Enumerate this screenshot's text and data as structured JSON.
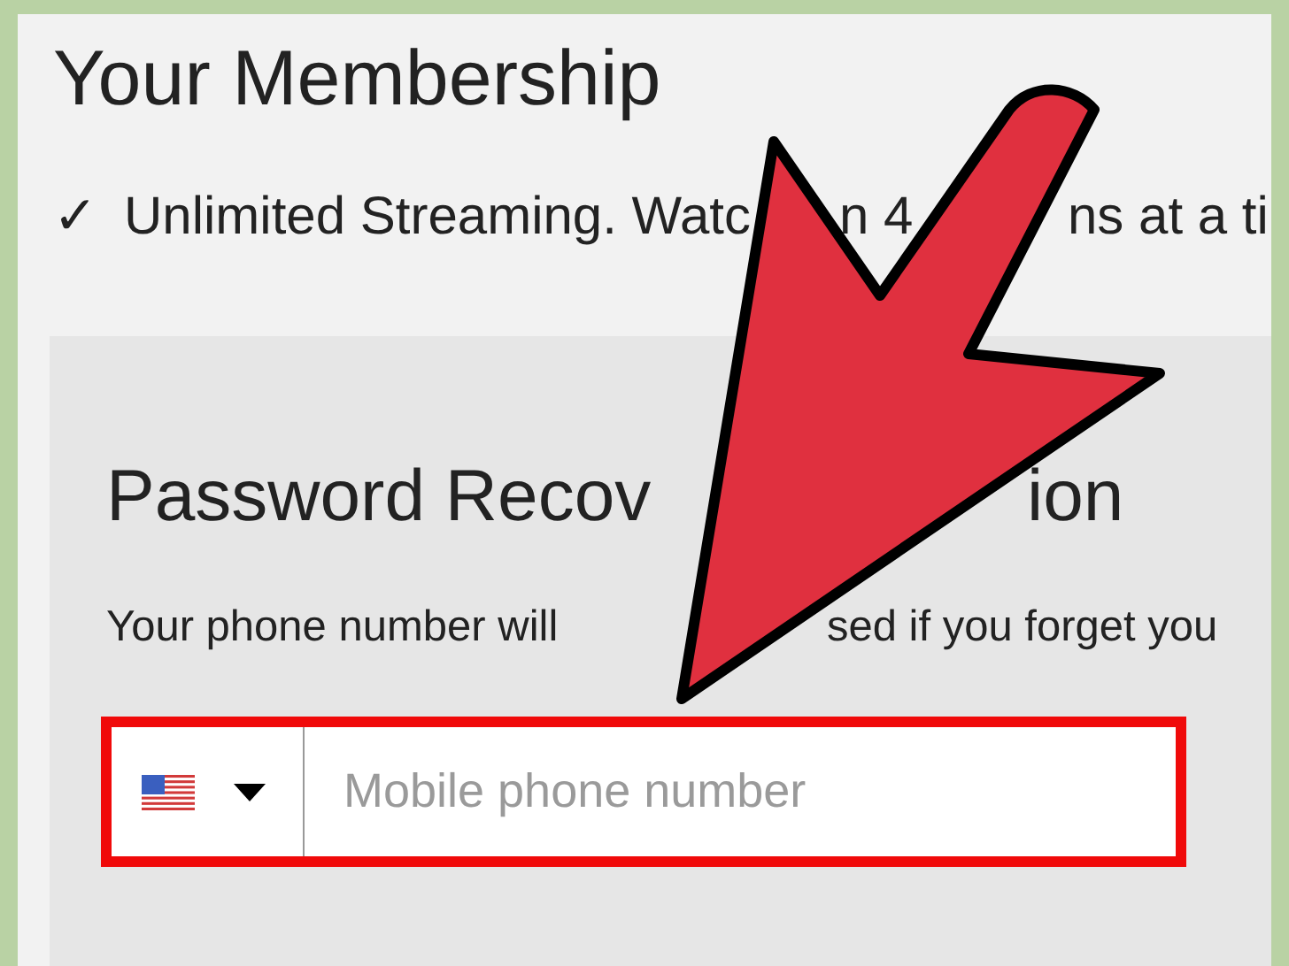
{
  "membership": {
    "title": "Your Membership",
    "check_mark": "✓",
    "feature_fragments": [
      "Unlimited Streaming. Watc",
      "n 4",
      "ns at a ti"
    ]
  },
  "recovery": {
    "title_fragments": [
      "Password Recov",
      "ion"
    ],
    "description_fragments": [
      "Your phone number will ",
      "sed if you forget you"
    ],
    "phone_field": {
      "placeholder": "Mobile phone number",
      "highlighted": true
    }
  }
}
